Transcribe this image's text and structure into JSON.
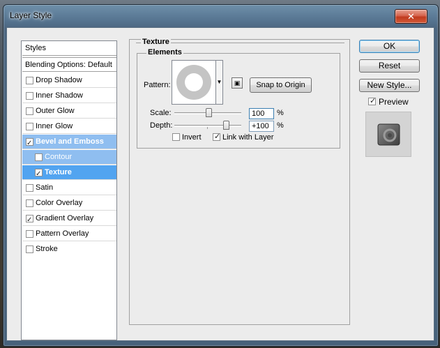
{
  "window": {
    "title": "Layer Style",
    "close_glyph": "✕"
  },
  "styles_list": {
    "header": "Styles",
    "blending": "Blending Options: Default",
    "items": [
      {
        "label": "Drop Shadow",
        "checked": false
      },
      {
        "label": "Inner Shadow",
        "checked": false
      },
      {
        "label": "Outer Glow",
        "checked": false
      },
      {
        "label": "Inner Glow",
        "checked": false
      },
      {
        "label": "Bevel and Emboss",
        "checked": true
      },
      {
        "label": "Contour",
        "checked": false
      },
      {
        "label": "Texture",
        "checked": true
      },
      {
        "label": "Satin",
        "checked": false
      },
      {
        "label": "Color Overlay",
        "checked": false
      },
      {
        "label": "Gradient Overlay",
        "checked": true
      },
      {
        "label": "Pattern Overlay",
        "checked": false
      },
      {
        "label": "Stroke",
        "checked": false
      }
    ]
  },
  "texture": {
    "group_title": "Texture",
    "elements_title": "Elements",
    "pattern_label": "Pattern:",
    "snap_button": "Snap to Origin",
    "scale_label": "Scale:",
    "scale_value": "100",
    "scale_unit": "%",
    "depth_label": "Depth:",
    "depth_value": "+100",
    "depth_unit": "%",
    "invert_label": "Invert",
    "invert_checked": false,
    "link_label": "Link with Layer",
    "link_checked": true
  },
  "buttons": {
    "ok": "OK",
    "reset": "Reset",
    "new_style": "New Style...",
    "preview_label": "Preview",
    "preview_checked": true
  }
}
